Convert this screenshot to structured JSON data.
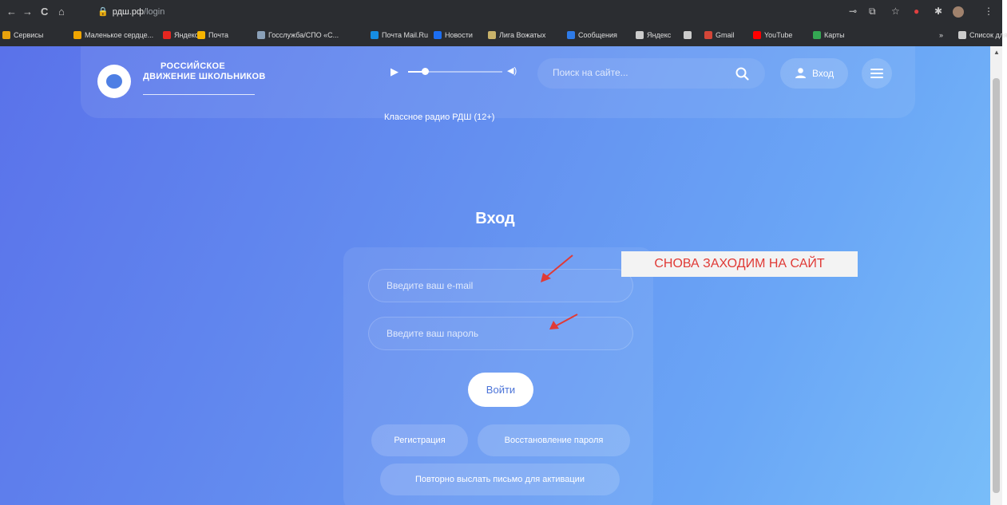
{
  "browser": {
    "nav": {
      "back": "←",
      "forward": "→",
      "reload": "C",
      "home": "⌂"
    },
    "url_domain": "рдш.рф",
    "url_path": "/login",
    "bookmarks": [
      {
        "label": "Сервисы",
        "color": "#e8a20c"
      },
      {
        "label": "Маленькое сердце...",
        "color": "#f0a500"
      },
      {
        "label": "Яндекс",
        "color": "#e52620"
      },
      {
        "label": "Почта",
        "color": "#f6b400"
      },
      {
        "label": "Госслужба/СПО «С...",
        "color": "#8aa0b8"
      },
      {
        "label": "Почта Mail.Ru",
        "color": "#168de2"
      },
      {
        "label": "Новости",
        "color": "#1c6ef2"
      },
      {
        "label": "Лига Вожатых",
        "color": "#c7b16a"
      },
      {
        "label": "Сообщения",
        "color": "#2e7be8"
      },
      {
        "label": "Яндекс",
        "color": "#cccccc"
      },
      {
        "label": "",
        "color": "#cccccc"
      },
      {
        "label": "Gmail",
        "color": "#d44638"
      },
      {
        "label": "YouTube",
        "color": "#ff0000"
      },
      {
        "label": "Карты",
        "color": "#34a853"
      }
    ],
    "bookmarks_more": "»",
    "reading_list": "Список для чтения"
  },
  "header": {
    "logo_line1": "РОССИЙСКОЕ",
    "logo_line2": "ДВИЖЕНИЕ ШКОЛЬНИКОВ",
    "radio_label": "Классное радио РДШ (12+)",
    "radio_progress": 0.18,
    "search_placeholder": "Поиск на сайте...",
    "login_label": "Вход"
  },
  "main": {
    "title": "Вход",
    "email_placeholder": "Введите ваш e-mail",
    "password_placeholder": "Введите ваш пароль",
    "submit_label": "Войти",
    "register_label": "Регистрация",
    "restore_label": "Восстановление пароля",
    "resend_label": "Повторно выслать письмо для активации"
  },
  "annotation": {
    "text": "СНОВА ЗАХОДИМ НА САЙТ",
    "color": "#e03a36"
  }
}
